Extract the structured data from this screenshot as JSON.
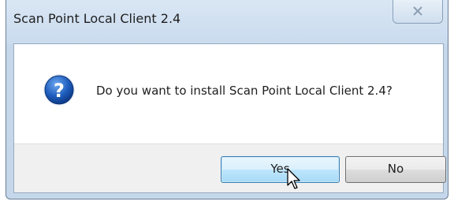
{
  "window": {
    "title": "Scan Point Local Client 2.4"
  },
  "message": {
    "text": "Do you want to install Scan Point Local Client 2.4?",
    "icon": "question-icon"
  },
  "buttons": {
    "yes": "Yes",
    "no": "No"
  },
  "colors": {
    "titlebar": "#c9dbee",
    "icon_blue": "#1f5fbf",
    "footer": "#f0f0f0"
  }
}
